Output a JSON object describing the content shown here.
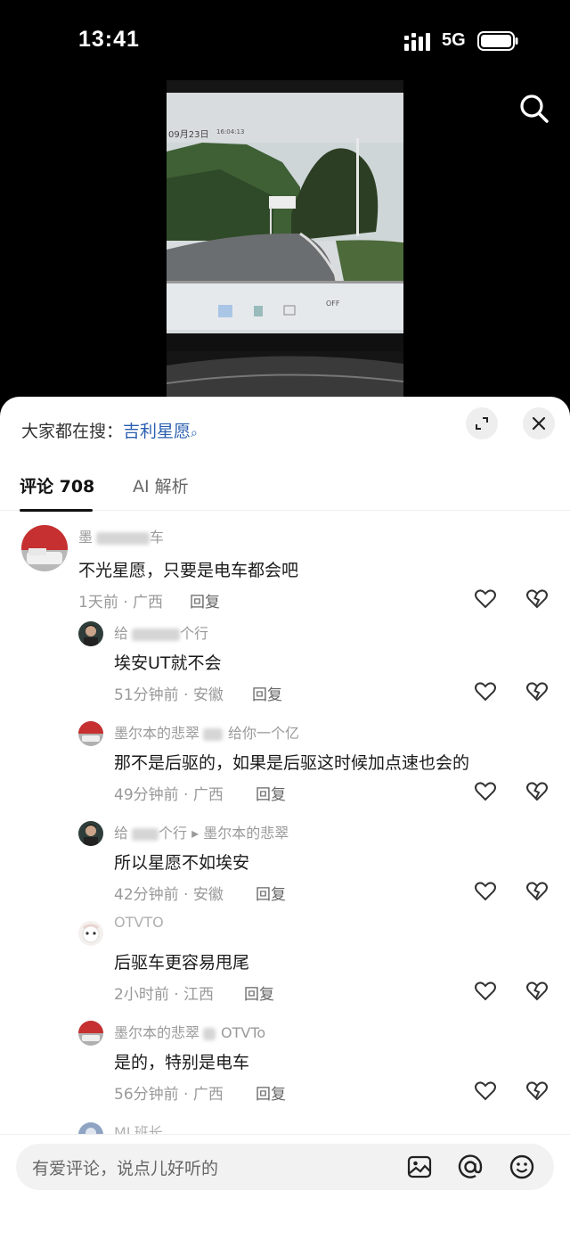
{
  "status_bar": {
    "time": "13:41",
    "network": "5G"
  },
  "video": {
    "timestamp_date": "09月23日",
    "timestamp_time": "16:04:13",
    "dashboard_off": "OFF"
  },
  "sheet": {
    "hot_search_prefix": "大家都在搜：",
    "hot_search_keyword": "吉利星愿",
    "hot_search_icon": "search-icon",
    "tabs": [
      {
        "label": "评论 708",
        "active": true
      },
      {
        "label": "AI 解析",
        "active": false
      }
    ]
  },
  "comments": [
    {
      "type": "main",
      "username_visible": "墨",
      "username_tail": "车",
      "text": "不光星愿，只要是电车都会吧",
      "time_location": "1天前 · 广西",
      "reply_label": "回复"
    },
    {
      "type": "reply",
      "username_visible": "给",
      "username_tail": "个行",
      "text": "埃安UT就不会",
      "time_location": "51分钟前 · 安徽",
      "reply_label": "回复"
    },
    {
      "type": "reply",
      "username_visible": "墨尔本的悲翠",
      "username_tail": "给你一个亿",
      "text": "那不是后驱的，如果是后驱这时候加点速也会的",
      "time_location": "49分钟前 · 广西",
      "reply_label": "回复"
    },
    {
      "type": "reply",
      "username_visible": "给",
      "username_tail": "个行 ▸ 墨尔本的悲翠",
      "text": "所以星愿不如埃安",
      "time_location": "42分钟前 · 安徽",
      "reply_label": "回复"
    },
    {
      "type": "reply",
      "username_visible": "OTVTO",
      "username_tail": "",
      "text": "后驱车更容易甩尾",
      "time_location": "2小时前 · 江西",
      "reply_label": "回复"
    },
    {
      "type": "reply",
      "username_visible": "墨尔本的悲翠",
      "username_tail": "OTVTo",
      "text": "是的，特别是电车",
      "time_location": "56分钟前 · 广西",
      "reply_label": "回复"
    },
    {
      "type": "reply",
      "username_visible": "ML班长",
      "username_tail": "",
      "text": "",
      "time_location": "",
      "reply_label": ""
    }
  ],
  "input_bar": {
    "placeholder": "有爱评论，说点儿好听的",
    "icons": [
      "image-icon",
      "at-icon",
      "emoji-icon"
    ]
  },
  "colors": {
    "keyword_blue": "#2a5fb0",
    "meta_gray": "#999999"
  }
}
